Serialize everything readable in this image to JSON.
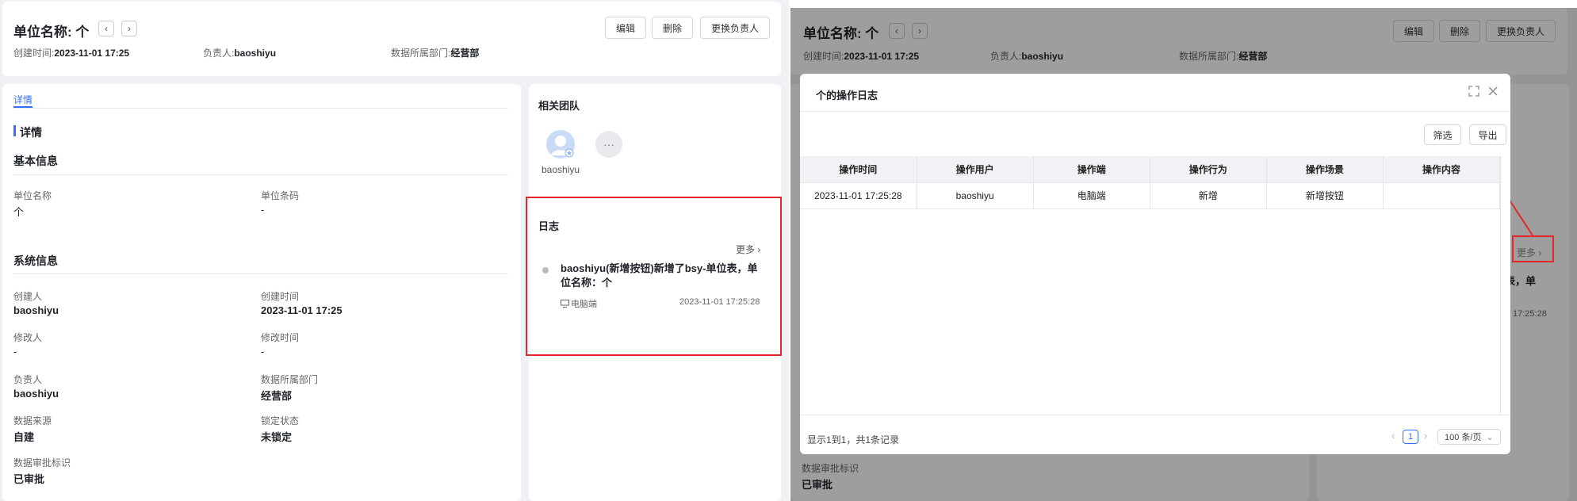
{
  "header": {
    "title": "单位名称: 个",
    "prev_icon": "chevron-left-icon",
    "next_icon": "chevron-right-icon",
    "buttons": {
      "edit": "编辑",
      "delete": "删除",
      "change_owner": "更换负责人"
    },
    "created_label": "创建时间:",
    "created_value": "2023-11-01 17:25",
    "owner_label": "负责人:",
    "owner_value": "baoshiyu",
    "dept_label": "数据所属部门:",
    "dept_value": "经营部"
  },
  "details": {
    "tab": "详情",
    "heading": "详情",
    "basic_section": "基本信息",
    "system_section": "系统信息",
    "fields": {
      "unit_name_label": "单位名称",
      "unit_name_value": "个",
      "unit_code_label": "单位条码",
      "unit_code_value": "-",
      "creator_label": "创建人",
      "creator_value": "baoshiyu",
      "create_time_label": "创建时间",
      "create_time_value": "2023-11-01 17:25",
      "modifier_label": "修改人",
      "modifier_value": "-",
      "modify_time_label": "修改时间",
      "modify_time_value": "-",
      "owner_label": "负责人",
      "owner_value": "baoshiyu",
      "dept_label": "数据所属部门",
      "dept_value": "经营部",
      "source_label": "数据来源",
      "source_value": "自建",
      "lock_label": "锁定状态",
      "lock_value": "未锁定",
      "approval_label": "数据审批标识",
      "approval_value": "已审批"
    }
  },
  "team": {
    "title": "相关团队",
    "member_name": "baoshiyu",
    "more_icon": "ellipsis-icon"
  },
  "log": {
    "title": "日志",
    "more": "更多",
    "entry_text": "baoshiyu(新增按钮)新增了bsy-单位表，单位名称：个",
    "entry_source": "电脑端",
    "entry_time": "2023-11-01 17:25:28"
  },
  "right_bg": {
    "partial_text": "表，单",
    "partial_time": "17:25:28",
    "more": "更多"
  },
  "modal": {
    "title": "个的操作日志",
    "filter_button": "筛选",
    "export_button": "导出",
    "columns": [
      "操作时间",
      "操作用户",
      "操作端",
      "操作行为",
      "操作场景",
      "操作内容"
    ],
    "rows": [
      [
        "2023-11-01 17:25:28",
        "baoshiyu",
        "电脑端",
        "新增",
        "新增按钮",
        ""
      ]
    ],
    "footer_text": "显示1到1，共1条记录",
    "current_page": "1",
    "page_size": "100 条/页"
  },
  "colors": {
    "accent": "#3370ff",
    "highlight": "#e5262b",
    "overlay": "#000000"
  }
}
